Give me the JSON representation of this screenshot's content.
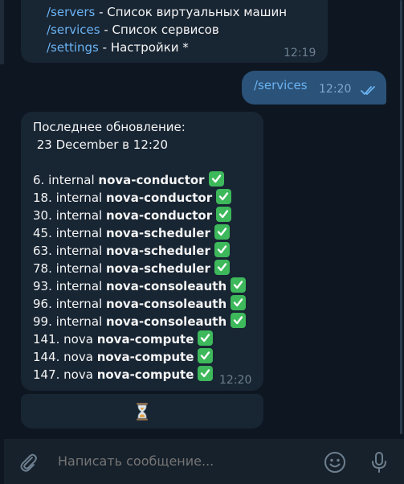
{
  "colors": {
    "background": "#0e1621",
    "bubble_in": "#182533",
    "bubble_out": "#2b5278",
    "link": "#6ab3f3",
    "check_green": "#3db85b"
  },
  "top_message": {
    "lines": [
      {
        "cmd": "/servers",
        "desc": " - Список виртуальных машин"
      },
      {
        "cmd": "/services",
        "desc": " - Список сервисов"
      },
      {
        "cmd": "/settings",
        "desc": " - Настройки *"
      }
    ],
    "time": "12:19"
  },
  "outgoing_message": {
    "text": "/services",
    "time": "12:20",
    "status_icon": "double-check-icon"
  },
  "services_message": {
    "header_line1": "Последнее обновление:",
    "header_line2": " 23 December в 12:20",
    "rows": [
      {
        "prefix": "6. internal ",
        "name": "nova-conductor"
      },
      {
        "prefix": "18. internal ",
        "name": "nova-conductor"
      },
      {
        "prefix": "30. internal ",
        "name": "nova-conductor"
      },
      {
        "prefix": "45. internal ",
        "name": "nova-scheduler"
      },
      {
        "prefix": "63. internal ",
        "name": "nova-scheduler"
      },
      {
        "prefix": "78. internal ",
        "name": "nova-scheduler"
      },
      {
        "prefix": "93. internal ",
        "name": "nova-consoleauth"
      },
      {
        "prefix": "96. internal ",
        "name": "nova-consoleauth"
      },
      {
        "prefix": "99. internal ",
        "name": "nova-consoleauth"
      },
      {
        "prefix": "141. nova ",
        "name": "nova-compute"
      },
      {
        "prefix": "144. nova ",
        "name": "nova-compute"
      },
      {
        "prefix": "147. nova ",
        "name": "nova-compute"
      }
    ],
    "status_icon": "white-check-mark-icon",
    "time": "12:20"
  },
  "inline_button": {
    "icon": "hourglass-icon"
  },
  "composer": {
    "placeholder": "Написать сообщение...",
    "attach_icon": "paperclip-icon",
    "emoji_icon": "smile-icon",
    "mic_icon": "microphone-icon"
  }
}
